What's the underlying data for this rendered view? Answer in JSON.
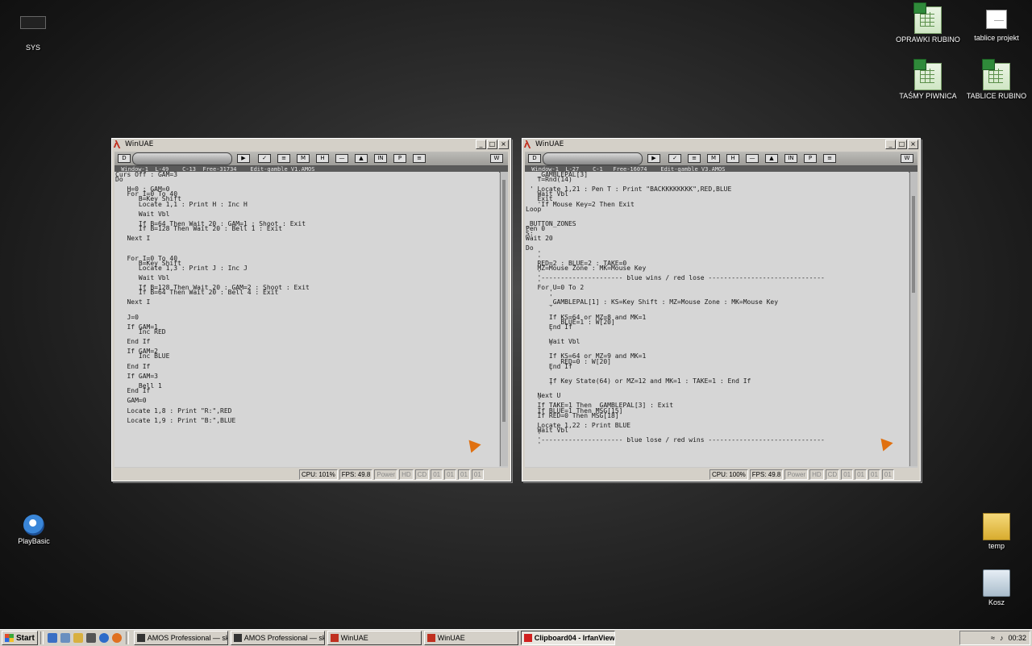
{
  "desktop": {
    "icons": {
      "sys": "SYS",
      "oprawki": "OPRAWKI RUBINO",
      "tablice_projekt": "tablice projekt",
      "tasmy": "TAŚMY PIWNICA",
      "tablice_rubino": "TABLICE RUBINO",
      "playbasic": "PlayBasic",
      "temp": "temp",
      "kosz": "Kosz"
    }
  },
  "window_left": {
    "title": "WinUAE",
    "info": " Window-1  L-49    C-13  Free-31734    Edit-gamble V1.AMOS",
    "code": "Curs Off : GAM=3\nDo\n\n   H=0 : GAM=0\n   For I=0 To 40\n      B=Key Shift\n      Locate 1,1 : Print H : Inc H\n\n      Wait Vbl\n\n      If B=64 Then Wait 20 : GAM=1 : Shoot : Exit\n      If B=128 Then Wait 20 : Bell 1 : Exit\n\n   Next I\n\n\n\n   For I=0 To 40\n      B=Key Shift\n      Locate 1,3 : Print J : Inc J\n\n      Wait Vbl\n\n      If B=128 Then Wait 20 : GAM=2 : Shoot : Exit\n      If B=64 Then Wait 20 : Bell 4 : Exit\n\n   Next I\n\n\n   J=0\n\n   If GAM=1\n      Inc RED\n\n   End If\n\n   If GAM=2\n      Inc BLUE\n\n   End If\n\n   If GAM=3\n\n      Bell 1\n   End If\n\n   GAM=0\n\n   Locate 1,8 : Print \"R:\",RED\n\n   Locate 1,9 : Print \"B:\",BLUE",
    "status": {
      "cpu": "CPU: 101%",
      "fps": "FPS: 49.8",
      "power": "Power",
      "hd": "HD",
      "cd": "CD",
      "df0": "01",
      "df1": "01",
      "df2": "01",
      "df3": "01"
    }
  },
  "window_right": {
    "title": "WinUAE",
    "info": " Window-1  L-27    C-1   Free-16074    Edit-gamble V3.AMOS",
    "code": "   _GAMBLEPAL[3]\n   T=Rnd(14)\n\n ' Locate 1,21 : Pen T : Print \"BACKKKKKKKK\",RED,BLUE\n   Wait Vbl\n   Exit\n   'If Mouse Key=2 Then Exit\nLoop\n\n\n_BUTTON_ZONES\nPen 0\nS:\nWait 20\n\nDo\n   '\n   '\n   RED=2 : BLUE=2 : TAKE=0\n   MZ=Mouse Zone : MK=Mouse Key\n   '\n   '--------------------- blue wins / red lose ------------------------------\n   '\n   For U=0 To 2\n      '\n      '\n      _GAMBLEPAL[1] : KS=Key Shift : MZ=Mouse Zone : MK=Mouse Key\n      '\n\n      If KS=64 or MZ=8 and MK=1\n         BLUE=1 : W[20]\n      End If\n      '\n\n      Wait Vbl\n      '\n\n      If KS=64 or MZ=9 and MK=1\n         RED=0 : W[20]\n      End If\n      '\n\n      If Key State(64) or MZ=12 and MK=1 : TAKE=1 : End If\n      '\n\n   Next U\n   '\n   If TAKE=1 Then _GAMBLEPAL[3] : Exit\n   If BLUE=1 Then MSG[15]\n   If RED=0 Then MSG[18]\n\n   Locate 1,22 : Print BLUE\n   Wait Vbl\n   '\n   '--------------------- blue lose / red wins ------------------------------\n   '",
    "status": {
      "cpu": "CPU: 100%",
      "fps": "FPS: 49.8",
      "power": "Power",
      "hd": "HD",
      "cd": "CD",
      "df0": "01",
      "df1": "01",
      "df2": "01",
      "df3": "01"
    }
  },
  "taskbar": {
    "start": "Start",
    "tasks": [
      "AMOS Professional — skrót",
      "AMOS Professional — skrót",
      "WinUAE",
      "WinUAE",
      "Clipboard04 - IrfanView"
    ],
    "clock": "00:32"
  }
}
